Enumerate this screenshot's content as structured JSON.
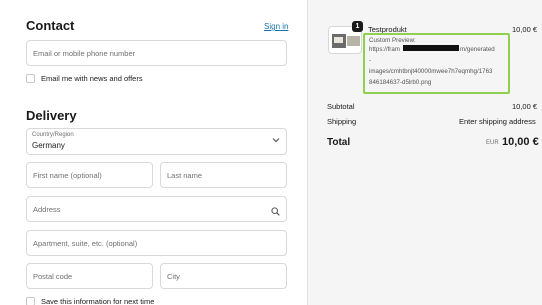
{
  "contact": {
    "heading": "Contact",
    "signin_link": "Sign in",
    "email_placeholder": "Email or mobile phone number",
    "news_label": "Email me with news and offers"
  },
  "delivery": {
    "heading": "Delivery",
    "country_label": "Country/Region",
    "country_value": "Germany",
    "first_name_placeholder": "First name (optional)",
    "last_name_placeholder": "Last name",
    "address_placeholder": "Address",
    "apartment_placeholder": "Apartment, suite, etc. (optional)",
    "postal_placeholder": "Postal code",
    "city_placeholder": "City",
    "save_label": "Save this information for next time"
  },
  "order": {
    "quantity": "1",
    "product_name": "Testprodukt",
    "product_price": "10,00 €",
    "preview_lines": [
      "Custom Preview:",
      "https://fram",
      "m/generated",
      "-",
      "images/cmhtbnjt40000mwee7h7eqmhg/1763",
      "846184637-d5lrb0.png"
    ],
    "subtotal_label": "Subtotal",
    "subtotal_value": "10,00 €",
    "shipping_label": "Shipping",
    "shipping_value": "Enter shipping address",
    "total_label": "Total",
    "currency": "EUR",
    "total_value": "10,00 €"
  }
}
